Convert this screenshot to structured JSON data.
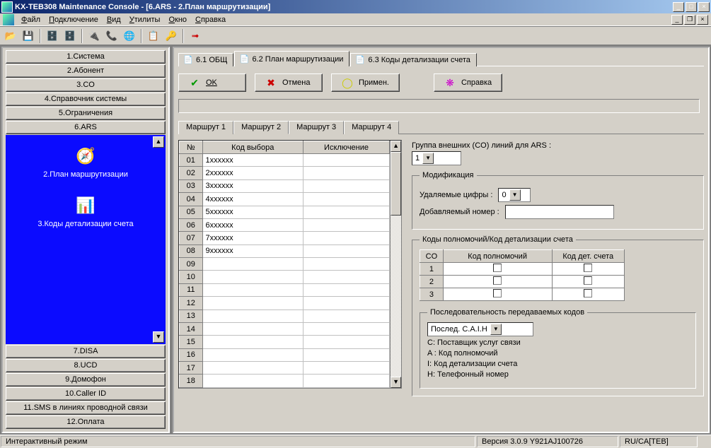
{
  "window": {
    "title": "KX-TEB308 Maintenance Console - [6.ARS - 2.План маршрутизации]"
  },
  "menu": {
    "file": "Файл",
    "connect": "Подключение",
    "view": "Вид",
    "utils": "Утилиты",
    "window": "Окно",
    "help": "Справка"
  },
  "sidebar": {
    "items": [
      "1.Система",
      "2.Абонент",
      "3.CO",
      "4.Справочник системы",
      "5.Ограничения",
      "6.ARS"
    ],
    "blue": [
      {
        "label": "2.План маршрутизации"
      },
      {
        "label": "3.Коды детализации счета"
      }
    ],
    "items2": [
      "7.DISA",
      "8.UCD",
      "9.Домофон",
      "10.Caller ID",
      "11.SMS в линиях проводной связи",
      "12.Оплата"
    ]
  },
  "toptabs": [
    {
      "label": "6.1 ОБЩ"
    },
    {
      "label": "6.2 План маршрутизации"
    },
    {
      "label": "6.3 Коды детализации счета"
    }
  ],
  "buttons": {
    "ok": "OK",
    "cancel": "Отмена",
    "apply": "Примен.",
    "help": "Справка"
  },
  "routeTabs": [
    "Маршрут 1",
    "Маршрут 2",
    "Маршрут 3",
    "Маршрут 4"
  ],
  "table": {
    "cols": [
      "№",
      "Код выбора",
      "Исключение"
    ],
    "rows": [
      {
        "n": "01",
        "code": "1xxxxxx",
        "exc": ""
      },
      {
        "n": "02",
        "code": "2xxxxxx",
        "exc": ""
      },
      {
        "n": "03",
        "code": "3xxxxxx",
        "exc": ""
      },
      {
        "n": "04",
        "code": "4xxxxxx",
        "exc": ""
      },
      {
        "n": "05",
        "code": "5xxxxxx",
        "exc": ""
      },
      {
        "n": "06",
        "code": "6xxxxxx",
        "exc": ""
      },
      {
        "n": "07",
        "code": "7xxxxxx",
        "exc": ""
      },
      {
        "n": "08",
        "code": "9xxxxxx",
        "exc": ""
      },
      {
        "n": "09",
        "code": "",
        "exc": ""
      },
      {
        "n": "10",
        "code": "",
        "exc": ""
      },
      {
        "n": "11",
        "code": "",
        "exc": ""
      },
      {
        "n": "12",
        "code": "",
        "exc": ""
      },
      {
        "n": "13",
        "code": "",
        "exc": ""
      },
      {
        "n": "14",
        "code": "",
        "exc": ""
      },
      {
        "n": "15",
        "code": "",
        "exc": ""
      },
      {
        "n": "16",
        "code": "",
        "exc": ""
      },
      {
        "n": "17",
        "code": "",
        "exc": ""
      },
      {
        "n": "18",
        "code": "",
        "exc": ""
      }
    ]
  },
  "right": {
    "groupLabel": "Группа внешних (CO) линий для ARS  :",
    "groupValue": "1",
    "modLegend": "Модификация",
    "delDigitsLabel": "Удаляемые цифры :",
    "delDigitsValue": "0",
    "addNumLabel": "Добавляемый номер :",
    "addNumValue": "",
    "authLegend": "Коды полномочий/Код детализации счета",
    "authCols": [
      "CO",
      "Код полномочий",
      "Код дет. счета"
    ],
    "authRows": [
      "1",
      "2",
      "3"
    ],
    "seqLegend": "Последовательность передаваемых кодов",
    "seqValue": "Послед. C.A.I.H",
    "seqC": "C: Поставщик услуг связи",
    "seqA": "A : Код полномочий",
    "seqI": "I: Код детализации счета",
    "seqH": "H: Телефонный номер"
  },
  "status": {
    "mode": "Интерактивный режим",
    "version": "Версия 3.0.9 Y921AJ100726",
    "conn": "RU/CA[TEB]"
  }
}
